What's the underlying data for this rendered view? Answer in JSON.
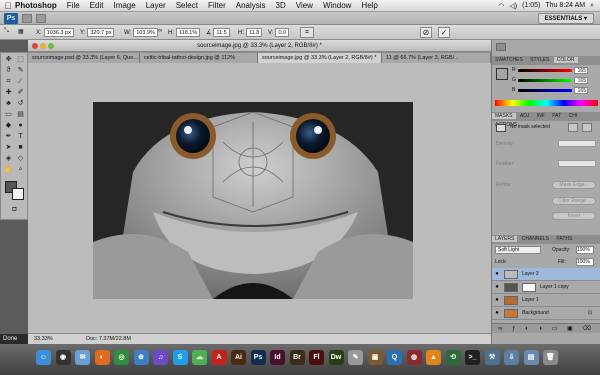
{
  "menubar": {
    "app": "Photoshop",
    "items": [
      "File",
      "Edit",
      "Image",
      "Layer",
      "Select",
      "Filter",
      "Analysis",
      "3D",
      "View",
      "Window",
      "Help"
    ],
    "status": {
      "battery": "(1:05)",
      "clock": "Thu 8:24 AM"
    }
  },
  "appbar": {
    "logo": "Ps",
    "workspace": "ESSENTIALS ▾"
  },
  "options": {
    "x_label": "X:",
    "x_val": "1036.3 px",
    "y_label": "Y:",
    "y_val": "320.7 px",
    "w_label": "W:",
    "w_val": "103.9%",
    "h_label": "H:",
    "h_val": "118.1%",
    "angle_val": "11.5",
    "h_skew_label": "H:",
    "h_skew_val": "11.8",
    "v_skew_label": "V:",
    "v_skew_val": "0.0"
  },
  "document": {
    "title": "sourceimage.jpg @ 33.3% (Layer 2, RGB/8#) *",
    "tabs": [
      "sourceimage.psd @ 33.3% (Layer 6, Que...",
      "celtic-tribal-tattoo-design.jpg @ 112%",
      "sourceimage.jpg @ 33.3% (Layer 2, RGB/8#) *",
      "11 @ 66.7% (Layer 3, RGB/..."
    ],
    "active_tab": 2,
    "zoom": "33.33%",
    "doc_info": "Doc: 7.37M/22.8M"
  },
  "done_badge": "Done",
  "panels": {
    "color_tabs": [
      "SWATCHES",
      "STYLES",
      "COLOR"
    ],
    "color_channels": [
      {
        "label": "R",
        "value": "165"
      },
      {
        "label": "G",
        "value": "165"
      },
      {
        "label": "B",
        "value": "165"
      }
    ],
    "mask_tabs": [
      "MASKS",
      "ADJ",
      "INF",
      "PAT",
      "CHI",
      "ACTIONS"
    ],
    "mask_status": "No mask selected",
    "density_label": "Density:",
    "feather_label": "Feather:",
    "refine_label": "Refine:",
    "mask_edge": "Mask Edge...",
    "color_range": "Color Range...",
    "invert": "Invert",
    "layer_tabs": [
      "LAYERS",
      "CHANNELS",
      "PATHS"
    ],
    "blend_mode": "Soft Light",
    "opacity_label": "Opacity:",
    "opacity": "100%",
    "lock_label": "Lock:",
    "fill_label": "Fill:",
    "fill": "100%",
    "layers": [
      {
        "name": "Layer 2",
        "selected": true
      },
      {
        "name": "Layer 1 copy",
        "selected": false
      },
      {
        "name": "Layer 1",
        "selected": false
      },
      {
        "name": "Background",
        "selected": false
      }
    ]
  },
  "dock": {
    "icons": [
      {
        "name": "finder-icon",
        "label": "☺",
        "color": "#3a8fd8"
      },
      {
        "name": "dashboard-icon",
        "label": "◉",
        "color": "#333"
      },
      {
        "name": "mail-icon",
        "label": "✉",
        "color": "#6aa0d6"
      },
      {
        "name": "firefox-icon",
        "label": "◐",
        "color": "#e06a1f"
      },
      {
        "name": "chrome-icon",
        "label": "◎",
        "color": "#2f8d3e"
      },
      {
        "name": "safari-icon",
        "label": "⊕",
        "color": "#3d7fc4"
      },
      {
        "name": "itunes-icon",
        "label": "♫",
        "color": "#6c4bc5"
      },
      {
        "name": "skype-icon",
        "label": "S",
        "color": "#1ea0e8"
      },
      {
        "name": "ichat-icon",
        "label": "☁",
        "color": "#4fb04f"
      },
      {
        "name": "acrobat-icon",
        "label": "A",
        "color": "#c4231b"
      },
      {
        "name": "illustrator-icon",
        "label": "Ai",
        "color": "#4a2b0f"
      },
      {
        "name": "photoshop-icon",
        "label": "Ps",
        "color": "#0f2d4f"
      },
      {
        "name": "indesign-icon",
        "label": "Id",
        "color": "#4b0e2f"
      },
      {
        "name": "bridge-icon",
        "label": "Br",
        "color": "#3a2a16"
      },
      {
        "name": "flash-icon",
        "label": "Fl",
        "color": "#4a0f0f"
      },
      {
        "name": "dreamweaver-icon",
        "label": "Dw",
        "color": "#254015"
      },
      {
        "name": "textedit-icon",
        "label": "✎",
        "color": "#999"
      },
      {
        "name": "preview-icon",
        "label": "▣",
        "color": "#7a5a32"
      },
      {
        "name": "quicktime-icon",
        "label": "Q",
        "color": "#2d6fb3"
      },
      {
        "name": "photobooth-icon",
        "label": "◍",
        "color": "#8a2a2a"
      },
      {
        "name": "vlc-icon",
        "label": "▲",
        "color": "#e08618"
      },
      {
        "name": "timemachine-icon",
        "label": "⟲",
        "color": "#2b6b3a"
      },
      {
        "name": "terminal-icon",
        "label": ">_",
        "color": "#222"
      },
      {
        "name": "xcode-icon",
        "label": "⚒",
        "color": "#4f6f8f"
      },
      {
        "name": "downloads-icon",
        "label": "⇩",
        "color": "#5b7fa5"
      },
      {
        "name": "documents-icon",
        "label": "▤",
        "color": "#6a89ad"
      },
      {
        "name": "trash-icon",
        "label": "🗑",
        "color": "#8a8a8a"
      }
    ]
  }
}
